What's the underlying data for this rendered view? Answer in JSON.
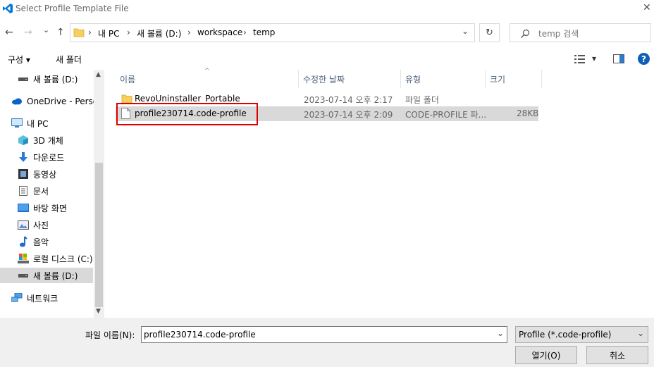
{
  "window": {
    "title": "Select Profile Template File",
    "close_glyph": "✕"
  },
  "nav": {
    "back": "←",
    "forward": "→",
    "recent": "⌄",
    "up": "↑",
    "path": [
      "내 PC",
      "새 볼륨 (D:)",
      "workspace",
      "temp"
    ],
    "separator": "›",
    "dropdown": "⌄",
    "refresh": "↻",
    "search_placeholder": "temp 검색"
  },
  "toolbar": {
    "organize": "구성 ▾",
    "new_folder": "새 폴더",
    "view_arrow": "▾",
    "help": "?"
  },
  "sidebar": {
    "items": [
      {
        "label": "새 볼륨 (D:)",
        "icon": "drive-icon"
      },
      {
        "label": "OneDrive - Person",
        "icon": "cloud-icon"
      },
      {
        "label": "내 PC",
        "icon": "pc-icon"
      },
      {
        "label": "3D 개체",
        "icon": "cube-icon"
      },
      {
        "label": "다운로드",
        "icon": "download-icon"
      },
      {
        "label": "동영상",
        "icon": "video-icon"
      },
      {
        "label": "문서",
        "icon": "document-icon"
      },
      {
        "label": "바탕 화면",
        "icon": "desktop-icon"
      },
      {
        "label": "사진",
        "icon": "picture-icon"
      },
      {
        "label": "음악",
        "icon": "music-icon"
      },
      {
        "label": "로컬 디스크 (C:)",
        "icon": "disk-icon"
      },
      {
        "label": "새 볼륨 (D:)",
        "icon": "drive-icon"
      },
      {
        "label": "네트워크",
        "icon": "network-icon"
      }
    ]
  },
  "columns": {
    "name": "이름",
    "modified": "수정한 날짜",
    "type": "유형",
    "size": "크기"
  },
  "files": [
    {
      "name": "RevoUninstaller_Portable",
      "modified": "2023-07-14 오후 2:17",
      "type": "파일 폴더",
      "size": "",
      "icon": "folder-icon"
    },
    {
      "name": "profile230714.code-profile",
      "modified": "2023-07-14 오후 2:09",
      "type": "CODE-PROFILE 파...",
      "size": "28KB",
      "icon": "file-icon"
    }
  ],
  "bottom": {
    "filename_label": "파일 이름(N):",
    "filename_value": "profile230714.code-profile",
    "filetype_value": "Profile (*.code-profile)",
    "open_label": "열기(O)",
    "cancel_label": "취소"
  },
  "colors": {
    "accent": "#0078d7",
    "highlight_border": "#e00000",
    "selected_row": "#d9d9d9"
  }
}
